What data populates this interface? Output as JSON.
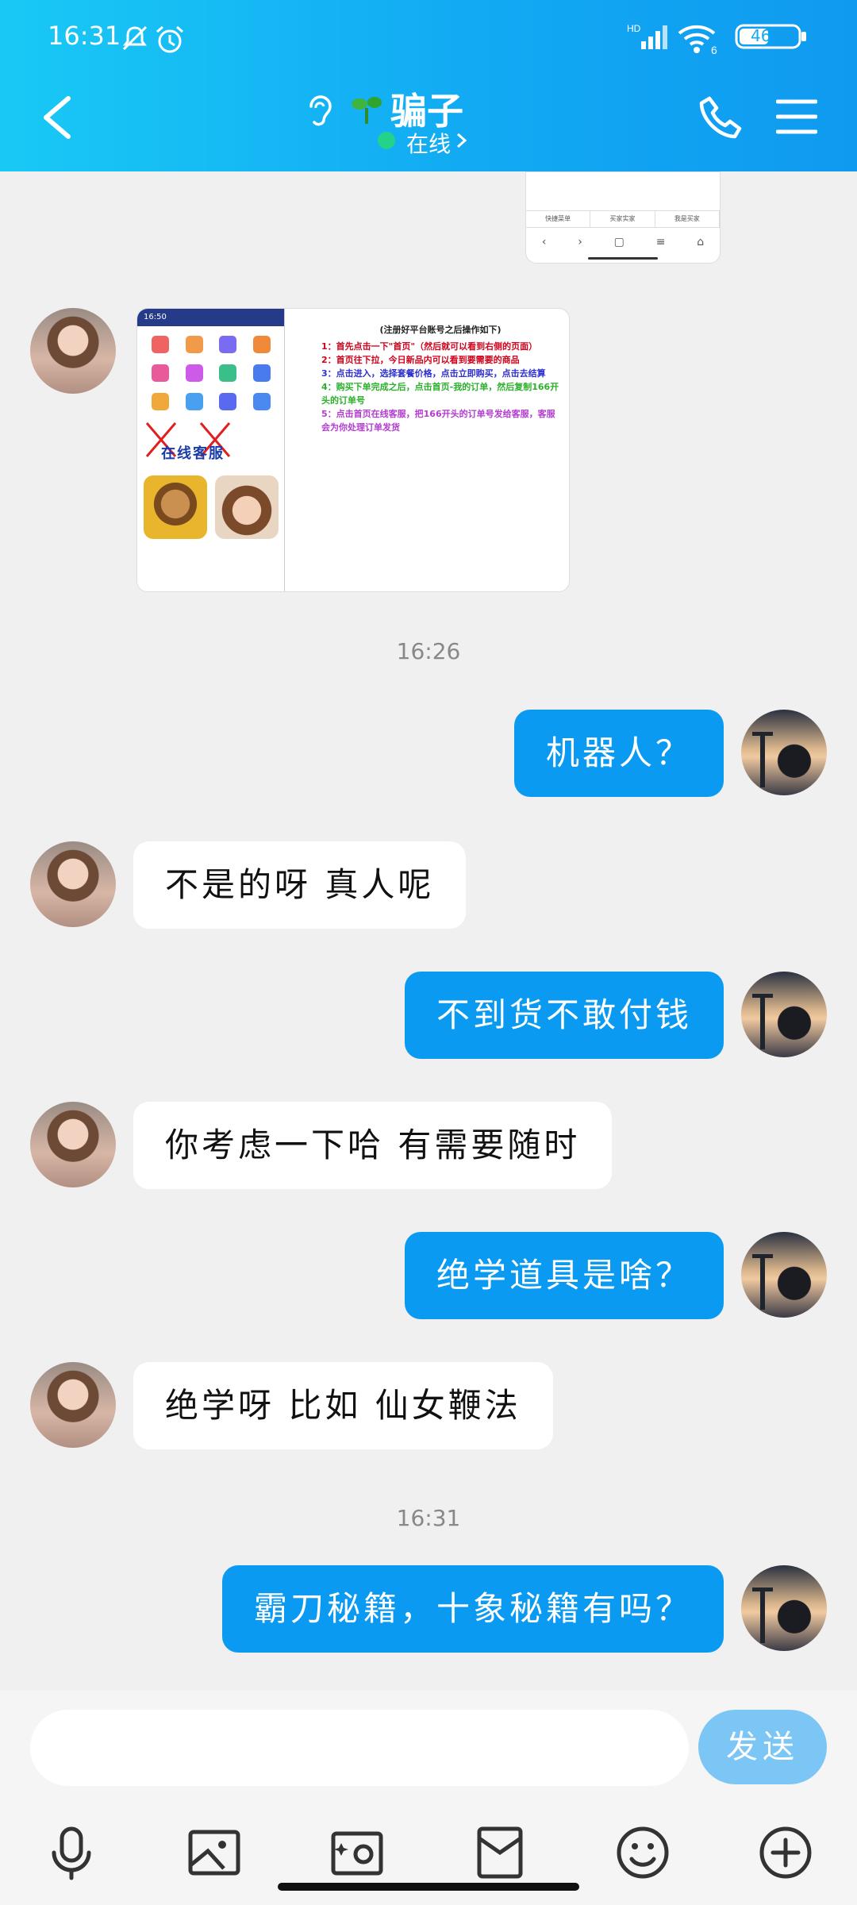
{
  "status_bar": {
    "time": "16:31",
    "network": "HD",
    "wifi_label": "6",
    "battery": "46"
  },
  "header": {
    "title": "骗子",
    "online_status": "在线",
    "colors": {
      "start": "#19c9f5",
      "end": "#0f9af0"
    }
  },
  "image_top": {
    "tabs": [
      "快捷菜单",
      "买家实家",
      "我是买家"
    ]
  },
  "image_message": {
    "service_label": "在线客服",
    "heading": "(注册好平台账号之后操作如下)",
    "lines": [
      {
        "text": "1：首先点击一下\"首页\"（然后就可以看到右侧的页面）",
        "color": "#d0021b"
      },
      {
        "text": "2：首页往下拉，今日新品内可以看到要需要的商品",
        "color": "#d0021b"
      },
      {
        "text": "3：点击进入，选择套餐价格，点击立即购买，点击去结算",
        "color": "#2d2fd0"
      },
      {
        "text": "4：购买下单完成之后，点击首页-我的订单，然后复制166开头的订单号",
        "color": "#2bb02b"
      },
      {
        "text": "5：点击首页在线客服，把166开头的订单号发给客服，客服会为你处理订单发货",
        "color": "#b33bd0"
      }
    ]
  },
  "messages": [
    {
      "time": "16:26"
    },
    {
      "side": "out",
      "text": "机器人？"
    },
    {
      "side": "in",
      "text": "不是的呀 真人呢"
    },
    {
      "side": "out",
      "text": "不到货不敢付钱"
    },
    {
      "side": "in",
      "text": "你考虑一下哈 有需要随时"
    },
    {
      "side": "out",
      "text": "绝学道具是啥？"
    },
    {
      "side": "in",
      "text": "绝学呀 比如 仙女鞭法"
    },
    {
      "time": "16:31"
    },
    {
      "side": "out",
      "text": "霸刀秘籍，十象秘籍有吗？"
    }
  ],
  "input": {
    "placeholder": "",
    "send_label": "发送"
  },
  "toolbar": {
    "icons": [
      "microphone-icon",
      "image-icon",
      "camera-icon",
      "red-packet-icon",
      "emoji-icon",
      "plus-icon"
    ]
  }
}
